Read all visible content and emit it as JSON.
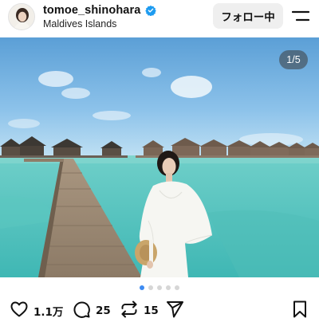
{
  "post": {
    "username": "tomoe_shinohara",
    "location": "Maldives Islands",
    "follow_label": "フォロー中",
    "carousel_counter": "1/5",
    "carousel_total": 5,
    "carousel_current": 1
  },
  "actions": {
    "likes": "1.1万",
    "comments": "25",
    "reposts": "15"
  },
  "icons": [
    "verified-icon",
    "menu-icon",
    "heart-icon",
    "comment-icon",
    "repost-icon",
    "share-icon",
    "bookmark-icon"
  ],
  "colors": {
    "verified": "#1d9bf0",
    "active_dot": "#3d8bf2",
    "follow_bg": "#efefef"
  }
}
